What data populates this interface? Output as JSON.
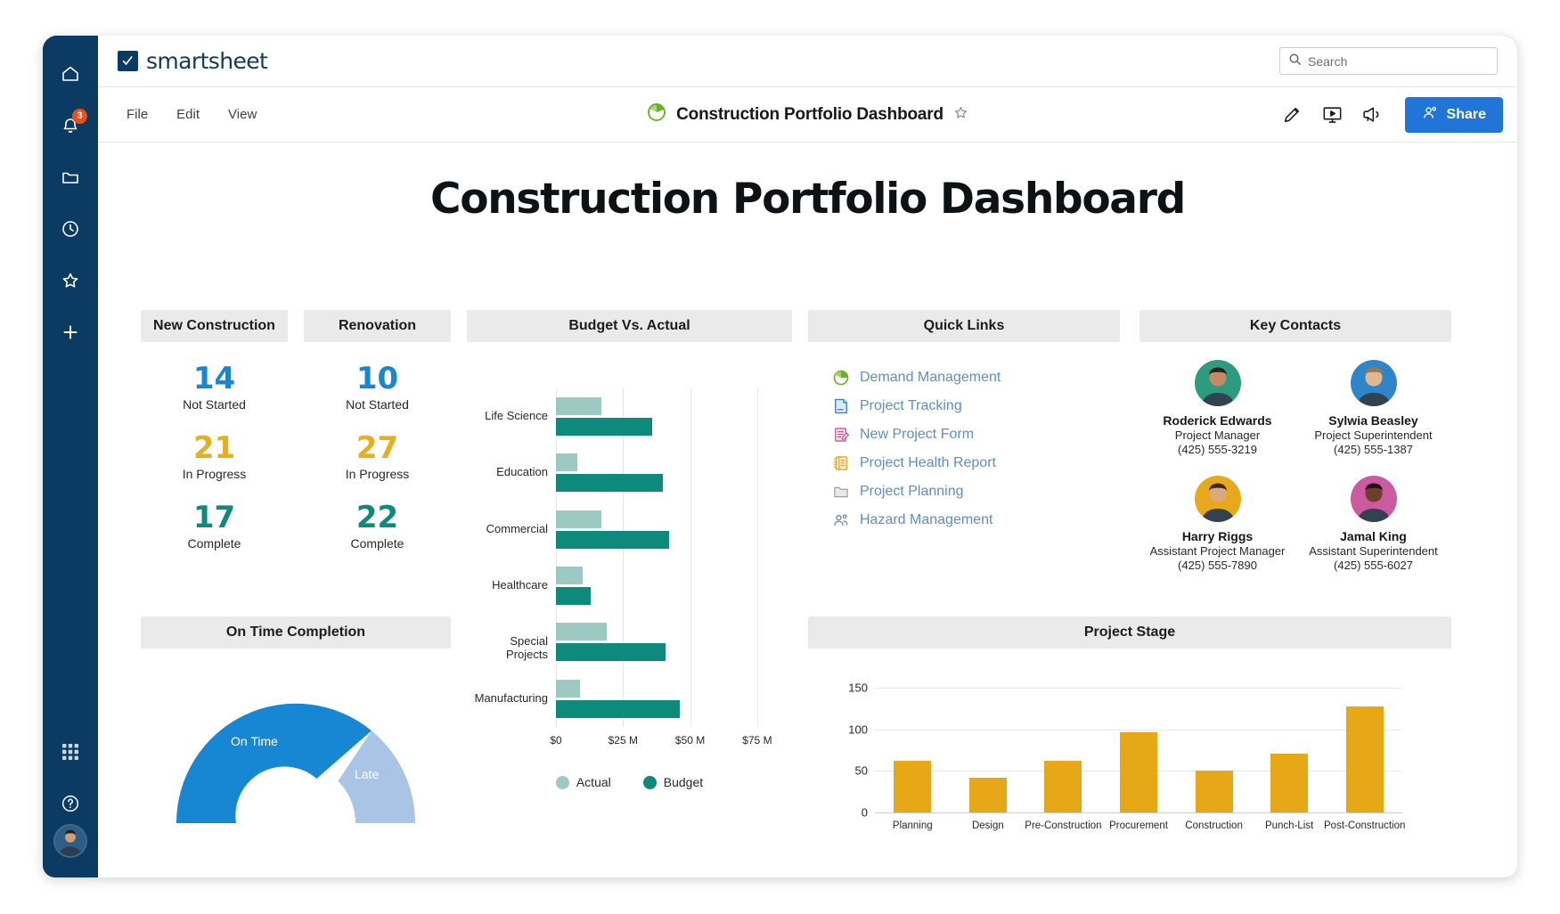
{
  "rail": {
    "items": [
      {
        "name": "home",
        "icon": "home-icon",
        "badge": ""
      },
      {
        "name": "notifications",
        "icon": "bell-icon",
        "badge": "3"
      },
      {
        "name": "browse",
        "icon": "folder-icon",
        "badge": ""
      },
      {
        "name": "recents",
        "icon": "clock-icon",
        "badge": ""
      },
      {
        "name": "favorites",
        "icon": "star-icon",
        "badge": ""
      },
      {
        "name": "create",
        "icon": "plus-icon",
        "badge": ""
      }
    ],
    "bottom": [
      {
        "name": "apps",
        "icon": "grid-apps-icon"
      },
      {
        "name": "help",
        "icon": "question-icon"
      },
      {
        "name": "account",
        "icon": "avatar"
      }
    ]
  },
  "topbar": {
    "brand": "smartsheet",
    "logo_glyph": "✓",
    "search": {
      "placeholder": "Search",
      "value": ""
    }
  },
  "menubar": {
    "items": [
      "File",
      "Edit",
      "View"
    ],
    "doc_title": "Construction Portfolio Dashboard",
    "doc_icon": "pie-chart-icon",
    "star_icon": "star-outline-icon",
    "tools": [
      "edit-pencil-icon",
      "presentation-icon",
      "announcement-icon"
    ],
    "share_label": "Share"
  },
  "dashboard": {
    "title": "Construction Portfolio Dashboard",
    "widgets": {
      "new_construction": {
        "header": "New Construction",
        "metrics": [
          {
            "value": "14",
            "label": "Not Started",
            "color": "#1787d4"
          },
          {
            "value": "21",
            "label": "In Progress",
            "color": "#e8ae1c"
          },
          {
            "value": "17",
            "label": "Complete",
            "color": "#0f8a7a"
          }
        ]
      },
      "renovation": {
        "header": "Renovation",
        "metrics": [
          {
            "value": "10",
            "label": "Not Started",
            "color": "#1787d4"
          },
          {
            "value": "27",
            "label": "In Progress",
            "color": "#e8ae1c"
          },
          {
            "value": "22",
            "label": "Complete",
            "color": "#0f8a7a"
          }
        ]
      },
      "budget_vs_actual": {
        "header": "Budget Vs. Actual"
      },
      "quick_links": {
        "header": "Quick Links",
        "links": [
          {
            "label": "Demand Management",
            "icon": "pie-chart-icon"
          },
          {
            "label": "Project Tracking",
            "icon": "sheet-icon"
          },
          {
            "label": "New Project Form",
            "icon": "form-icon"
          },
          {
            "label": "Project Health Report",
            "icon": "report-icon"
          },
          {
            "label": "Project Planning",
            "icon": "folder-icon"
          },
          {
            "label": "Hazard Management",
            "icon": "workspace-icon"
          }
        ]
      },
      "key_contacts": {
        "header": "Key Contacts",
        "contacts": [
          {
            "name": "Roderick Edwards",
            "role": "Project Manager",
            "phone": "(425) 555-3219",
            "avatar_bg": "#2d9b80",
            "skin": "#c48a63",
            "hair": "#2e2119"
          },
          {
            "name": "Sylwia Beasley",
            "role": "Project Superintendent",
            "phone": "(425) 555-1387",
            "avatar_bg": "#2e86c8",
            "skin": "#e2b892",
            "hair": "#a37745"
          },
          {
            "name": "Harry Riggs",
            "role": "Assistant Project Manager",
            "phone": "(425) 555-7890",
            "avatar_bg": "#e8a81c",
            "skin": "#dca97f",
            "hair": "#3a2a1d"
          },
          {
            "name": "Jamal King",
            "role": "Assistant Superintendent",
            "phone": "(425) 555-6027",
            "avatar_bg": "#cc5aa0",
            "skin": "#6b3f28",
            "hair": "#1a1010"
          }
        ]
      },
      "on_time_completion": {
        "header": "On Time Completion"
      },
      "project_stage": {
        "header": "Project Stage"
      }
    }
  },
  "chart_data": [
    {
      "type": "bar",
      "orientation": "horizontal",
      "title": "Budget Vs. Actual",
      "categories": [
        "Life Science",
        "Education",
        "Commercial",
        "Healthcare",
        "Special Projects",
        "Manufacturing"
      ],
      "series": [
        {
          "name": "Actual",
          "color": "#9cc9c1",
          "values": [
            17,
            8,
            17,
            10,
            19,
            9
          ]
        },
        {
          "name": "Budget",
          "color": "#0d8a7b",
          "values": [
            36,
            40,
            42,
            13,
            41,
            46
          ]
        }
      ],
      "xlabel": "",
      "ylabel": "",
      "xticks": [
        "$0",
        "$25 M",
        "$50 M",
        "$75 M"
      ],
      "xtick_values": [
        0,
        25,
        50,
        75
      ],
      "xlim": [
        0,
        83
      ],
      "unit": "USD millions",
      "grid": true,
      "legend": "bottom",
      "legend_entries": [
        "Actual",
        "Budget"
      ]
    },
    {
      "type": "pie",
      "subtype": "half-donut-gauge",
      "title": "On Time Completion",
      "labels": [
        "On Time",
        "Late"
      ],
      "values": [
        72,
        28
      ],
      "colors": [
        "#1787d4",
        "#aac4e6"
      ],
      "label_colors": [
        "#ffffff",
        "#ffffff"
      ]
    },
    {
      "type": "bar",
      "orientation": "vertical",
      "title": "Project Stage",
      "categories": [
        "Planning",
        "Design",
        "Pre-Construction",
        "Procurement",
        "Construction",
        "Punch-List",
        "Post-Construction"
      ],
      "values": [
        62,
        42,
        62,
        96,
        50,
        71,
        128
      ],
      "color": "#e6a817",
      "xlabel": "",
      "ylabel": "",
      "yticks": [
        0,
        50,
        100,
        150
      ],
      "ylim": [
        0,
        150
      ],
      "grid": true
    }
  ],
  "colors": {
    "brand_navy": "#0b3a63",
    "accent_blue": "#2175d9",
    "teal": "#0d8a7b",
    "amber": "#e6a817",
    "link_blue": "#5d8ec4",
    "header_grey": "#eaeaea"
  }
}
